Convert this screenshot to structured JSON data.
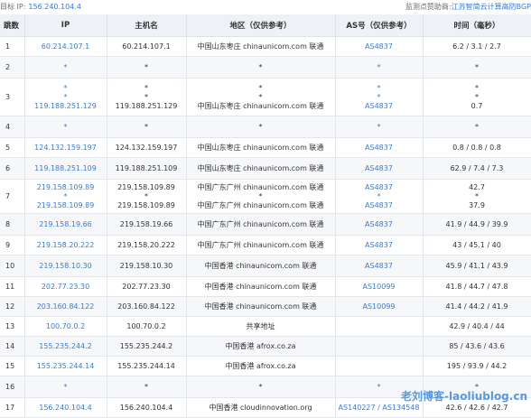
{
  "header": {
    "target_label": "目标 IP:",
    "target_ip": "156.240.104.4",
    "sponsor_label": "监测点赞助商:",
    "sponsor_name": "江苏智简云计算高防BGP"
  },
  "columns": [
    "跳数",
    "IP",
    "主机名",
    "地区（仅供参考）",
    "AS号（仅供参考）",
    "时间（毫秒）"
  ],
  "rows": [
    {
      "hop": "1",
      "ip": [
        "60.214.107.1"
      ],
      "host": [
        "60.214.107.1"
      ],
      "region": [
        "中国山东枣庄 chinaunicom.com 联通"
      ],
      "as": [
        "AS4837"
      ],
      "time": [
        "6.2 / 3.1 / 2.7"
      ]
    },
    {
      "hop": "2",
      "ip": [
        "*"
      ],
      "host": [
        "*"
      ],
      "region": [
        "*"
      ],
      "as": [
        "*"
      ],
      "time": [
        "*"
      ]
    },
    {
      "hop": "3",
      "ip": [
        "*",
        "*",
        "119.188.251.129"
      ],
      "host": [
        "*",
        "*",
        "119.188.251.129"
      ],
      "region": [
        "*",
        "*",
        "中国山东枣庄 chinaunicom.com 联通"
      ],
      "as": [
        "*",
        "*",
        "AS4837"
      ],
      "time": [
        "*",
        "*",
        "0.7"
      ]
    },
    {
      "hop": "4",
      "ip": [
        "*"
      ],
      "host": [
        "*"
      ],
      "region": [
        "*"
      ],
      "as": [
        "*"
      ],
      "time": [
        "*"
      ]
    },
    {
      "hop": "5",
      "ip": [
        "124.132.159.197"
      ],
      "host": [
        "124.132.159.197"
      ],
      "region": [
        "中国山东枣庄 chinaunicom.com 联通"
      ],
      "as": [
        "AS4837"
      ],
      "time": [
        "0.8 / 0.8 / 0.8"
      ]
    },
    {
      "hop": "6",
      "ip": [
        "119.188.251.109"
      ],
      "host": [
        "119.188.251.109"
      ],
      "region": [
        "中国山东枣庄 chinaunicom.com 联通"
      ],
      "as": [
        "AS4837"
      ],
      "time": [
        "62.9 / 7.4 / 7.3"
      ]
    },
    {
      "hop": "7",
      "ip": [
        "219.158.109.89",
        "*",
        "219.158.109.89"
      ],
      "host": [
        "219.158.109.89",
        "*",
        "219.158.109.89"
      ],
      "region": [
        "中国广东广州 chinaunicom.com 联通",
        "*",
        "中国广东广州 chinaunicom.com 联通"
      ],
      "as": [
        "AS4837",
        "*",
        "AS4837"
      ],
      "time": [
        "42.7",
        "*",
        "37.9"
      ]
    },
    {
      "hop": "8",
      "ip": [
        "219.158.19.66"
      ],
      "host": [
        "219.158.19.66"
      ],
      "region": [
        "中国广东广州 chinaunicom.com 联通"
      ],
      "as": [
        "AS4837"
      ],
      "time": [
        "41.9 / 44.9 / 39.9"
      ]
    },
    {
      "hop": "9",
      "ip": [
        "219.158.20.222"
      ],
      "host": [
        "219.158.20.222"
      ],
      "region": [
        "中国广东广州 chinaunicom.com 联通"
      ],
      "as": [
        "AS4837"
      ],
      "time": [
        "43 / 45.1 / 40"
      ]
    },
    {
      "hop": "10",
      "ip": [
        "219.158.10.30"
      ],
      "host": [
        "219.158.10.30"
      ],
      "region": [
        "中国香港 chinaunicom.com 联通"
      ],
      "as": [
        "AS4837"
      ],
      "time": [
        "45.9 / 41.1 / 43.9"
      ]
    },
    {
      "hop": "11",
      "ip": [
        "202.77.23.30"
      ],
      "host": [
        "202.77.23.30"
      ],
      "region": [
        "中国香港 chinaunicom.com 联通"
      ],
      "as": [
        "AS10099"
      ],
      "time": [
        "41.8 / 44.7 / 47.8"
      ]
    },
    {
      "hop": "12",
      "ip": [
        "203.160.84.122"
      ],
      "host": [
        "203.160.84.122"
      ],
      "region": [
        "中国香港 chinaunicom.com 联通"
      ],
      "as": [
        "AS10099"
      ],
      "time": [
        "41.4 / 44.2 / 41.9"
      ]
    },
    {
      "hop": "13",
      "ip": [
        "100.70.0.2"
      ],
      "host": [
        "100.70.0.2"
      ],
      "region": [
        "共享地址"
      ],
      "as": [
        ""
      ],
      "time": [
        "42.9 / 40.4 / 44"
      ]
    },
    {
      "hop": "14",
      "ip": [
        "155.235.244.2"
      ],
      "host": [
        "155.235.244.2"
      ],
      "region": [
        "中国香港 afrox.co.za"
      ],
      "as": [
        ""
      ],
      "time": [
        "85 / 43.6 / 43.6"
      ]
    },
    {
      "hop": "15",
      "ip": [
        "155.235.244.14"
      ],
      "host": [
        "155.235.244.14"
      ],
      "region": [
        "中国香港 afrox.co.za"
      ],
      "as": [
        ""
      ],
      "time": [
        "195 / 93.9 / 44.2"
      ]
    },
    {
      "hop": "16",
      "ip": [
        "*"
      ],
      "host": [
        "*"
      ],
      "region": [
        "*"
      ],
      "as": [
        "*"
      ],
      "time": [
        "*"
      ]
    },
    {
      "hop": "17",
      "ip": [
        "156.240.104.4"
      ],
      "host": [
        "156.240.104.4"
      ],
      "region": [
        "中国香港 cloudinnovation.org"
      ],
      "as": [
        "AS140227 / AS134548"
      ],
      "time": [
        "42.6 / 42.6 / 42.7"
      ]
    }
  ],
  "watermark": "老刘博客-laoliublog.cn"
}
